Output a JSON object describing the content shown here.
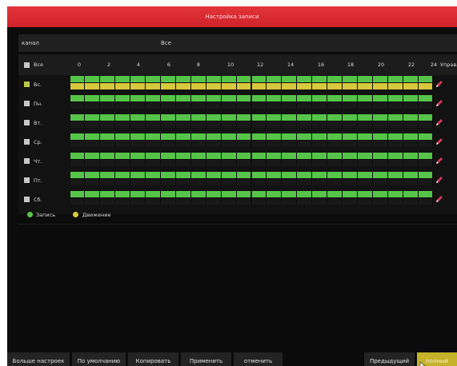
{
  "window": {
    "title": "Настройка записи"
  },
  "channel": {
    "label": "канал",
    "value": "Все"
  },
  "header": {
    "all_label": "Все",
    "hours": [
      "0",
      "2",
      "4",
      "6",
      "8",
      "10",
      "12",
      "14",
      "16",
      "18",
      "20",
      "22",
      "24"
    ],
    "manage_label": "Управле"
  },
  "days": [
    {
      "label": "Вс.",
      "checked": true,
      "motion": true
    },
    {
      "label": "Пн.",
      "checked": false,
      "motion": false
    },
    {
      "label": "Вт.",
      "checked": false,
      "motion": false
    },
    {
      "label": "Ср.",
      "checked": false,
      "motion": false
    },
    {
      "label": "Чт.",
      "checked": false,
      "motion": false
    },
    {
      "label": "Пт.",
      "checked": false,
      "motion": false
    },
    {
      "label": "Сб.",
      "checked": false,
      "motion": false
    }
  ],
  "legend": {
    "record": "Запись",
    "motion": "Движение"
  },
  "buttons": {
    "more": "Больше настроек",
    "default": "По умолчанию",
    "copy": "Копировать",
    "apply": "Применить",
    "cancel": "отменить",
    "previous": "Предыдущий шаг",
    "full": "полный"
  },
  "colors": {
    "title_bar": "#d0222a",
    "record": "#56c449",
    "motion": "#d8c83c",
    "accent_button": "#c5b12a"
  }
}
